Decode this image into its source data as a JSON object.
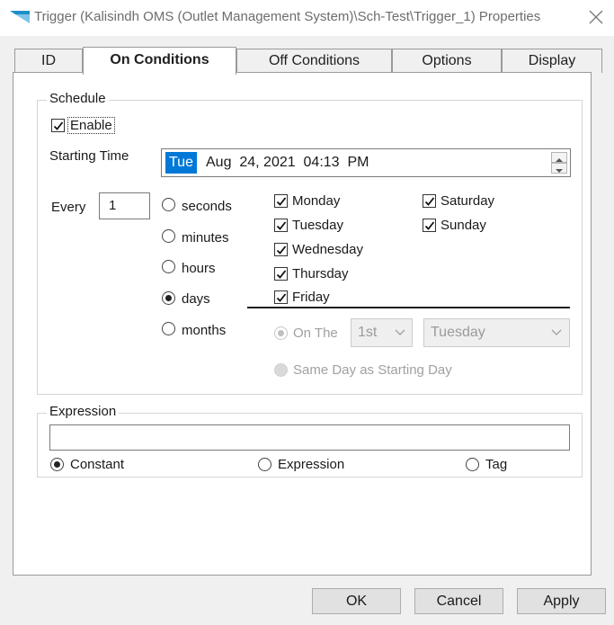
{
  "window": {
    "title": "Trigger (Kalisindh OMS (Outlet Management System)\\Sch-Test\\Trigger_1) Properties"
  },
  "tabs": [
    {
      "label": "ID",
      "active": false
    },
    {
      "label": "On Conditions",
      "active": true
    },
    {
      "label": "Off Conditions",
      "active": false
    },
    {
      "label": "Options",
      "active": false
    },
    {
      "label": "Display",
      "active": false
    }
  ],
  "schedule": {
    "group_label": "Schedule",
    "enable": {
      "label": "Enable",
      "checked": true
    },
    "starting_time_label": "Starting Time",
    "starting_time": {
      "day": "Tue",
      "rest": "Aug  24, 2021  04:13  PM"
    },
    "every_label": "Every",
    "every_value": "1",
    "intervals": [
      {
        "label": "seconds",
        "selected": false
      },
      {
        "label": "minutes",
        "selected": false
      },
      {
        "label": "hours",
        "selected": false
      },
      {
        "label": "days",
        "selected": true
      },
      {
        "label": "months",
        "selected": false
      }
    ],
    "weekdays_left": [
      {
        "label": "Monday",
        "checked": true
      },
      {
        "label": "Tuesday",
        "checked": true
      },
      {
        "label": "Wednesday",
        "checked": true
      },
      {
        "label": "Thursday",
        "checked": true
      },
      {
        "label": "Friday",
        "checked": true
      }
    ],
    "weekdays_right": [
      {
        "label": "Saturday",
        "checked": true
      },
      {
        "label": "Sunday",
        "checked": true
      }
    ],
    "on_the": {
      "label": "On The",
      "ordinal": "1st",
      "weekday": "Tuesday",
      "enabled": false
    },
    "same_day_label": "Same Day as Starting Day"
  },
  "expression": {
    "group_label": "Expression",
    "value": "",
    "options": [
      {
        "label": "Constant",
        "selected": true
      },
      {
        "label": "Expression",
        "selected": false
      },
      {
        "label": "Tag",
        "selected": false
      }
    ]
  },
  "buttons": {
    "ok": "OK",
    "cancel": "Cancel",
    "apply": "Apply"
  },
  "colors": {
    "accent": "#0078d7",
    "app_icon": "#1e8fc9"
  },
  "icons": {
    "app": "trigger-app-icon",
    "close": "close-icon",
    "dropdown": "chevron-down-icon",
    "check": "check-icon"
  }
}
